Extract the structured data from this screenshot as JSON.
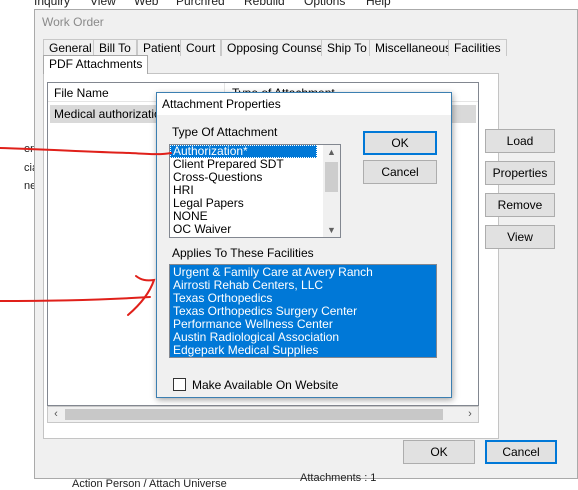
{
  "menubar": [
    "Inquiry",
    "View",
    "Web",
    "Purchred",
    "Rebuild",
    "Options",
    "Help"
  ],
  "left_edge_fragments": [
    "ent",
    "cia",
    "ner"
  ],
  "window": {
    "title": "Work Order",
    "tabs": [
      {
        "label": "General",
        "active": false
      },
      {
        "label": "Bill To",
        "active": false
      },
      {
        "label": "Patient",
        "active": false
      },
      {
        "label": "Court",
        "active": false
      },
      {
        "label": "Opposing Counsel",
        "active": false
      },
      {
        "label": "Ship To",
        "active": false
      },
      {
        "label": "Miscellaneous",
        "active": false
      },
      {
        "label": "Facilities",
        "active": false
      },
      {
        "label": "PDF Attachments",
        "active": true
      }
    ],
    "attachments_list": {
      "columns": [
        "File Name",
        "Type of Attachment"
      ],
      "rows": [
        {
          "file_name": "Medical authorization",
          "type": ""
        }
      ]
    },
    "side_buttons": [
      "Load",
      "Properties",
      "Remove",
      "View"
    ],
    "ok_label": "OK",
    "cancel_label": "Cancel",
    "status_attachments": "Attachments : 1",
    "bottom_text": "Action Person / Attach Universe"
  },
  "dialog": {
    "title": "Attachment Properties",
    "type_label": "Type Of Attachment",
    "type_options": [
      "Authorization*",
      "Client Prepared SDT",
      "Cross-Questions",
      "HRI",
      "Legal Papers",
      "NONE",
      "OC Waiver"
    ],
    "type_selected": "Authorization*",
    "facilities_label": "Applies To These Facilities",
    "facilities": [
      "Urgent & Family Care at Avery Ranch",
      "Airrosti Rehab Centers, LLC",
      "Texas Orthopedics",
      "Texas Orthopedics Surgery Center",
      "Performance Wellness Center",
      "Austin Radiological Association",
      "Edgepark Medical Supplies"
    ],
    "website_checkbox_label": "Make Available On Website",
    "website_checked": false,
    "ok_label": "OK",
    "cancel_label": "Cancel"
  },
  "colors": {
    "selection": "#0078d7",
    "annotation": "#e0201a"
  }
}
